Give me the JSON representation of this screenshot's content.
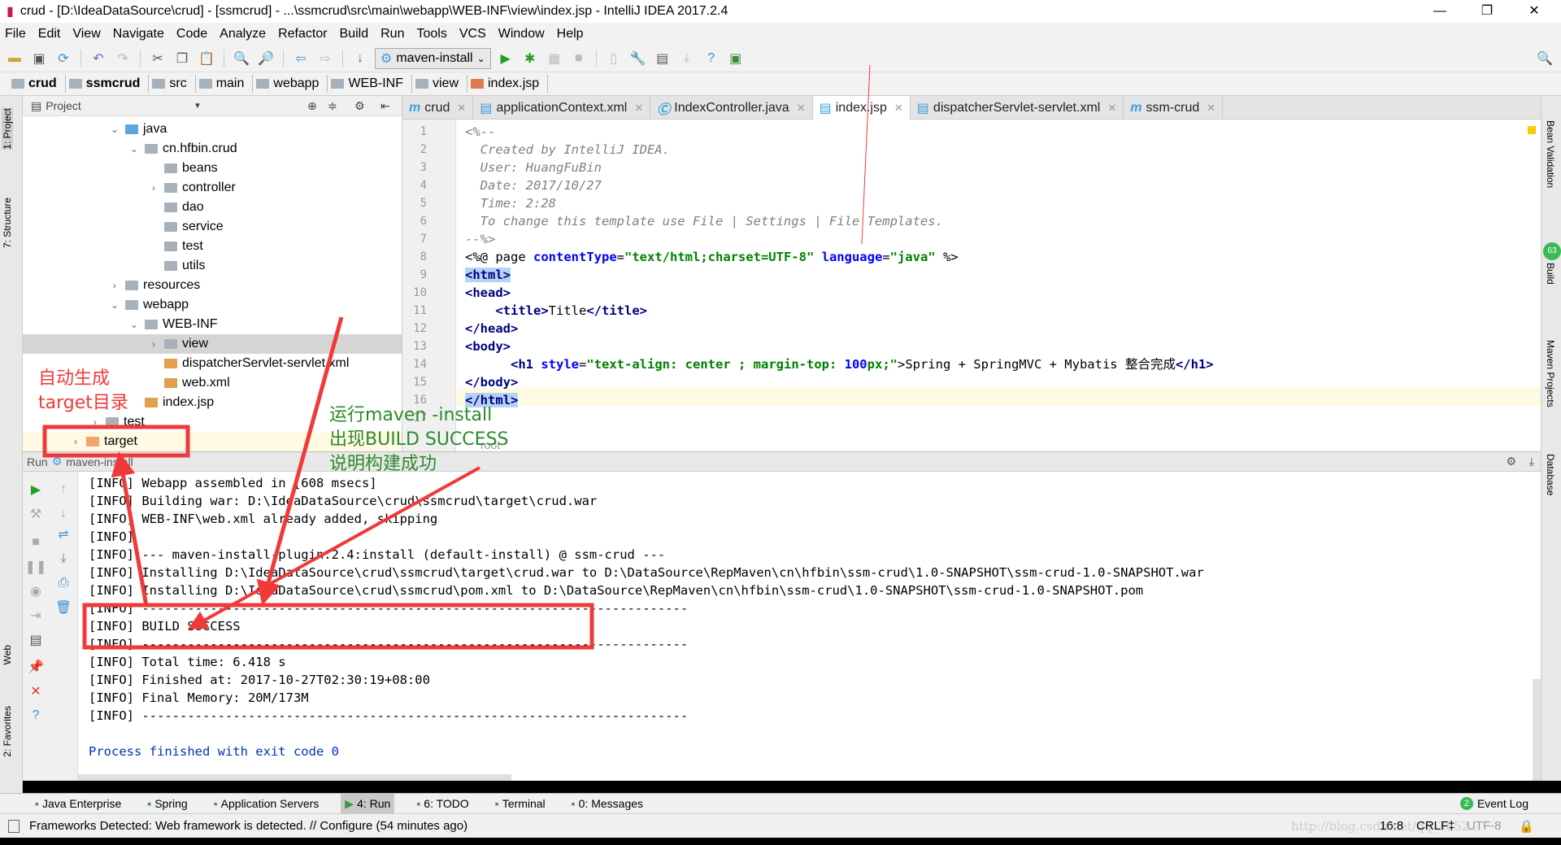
{
  "window": {
    "title": "crud - [D:\\IdeaDataSource\\crud] - [ssmcrud] - ...\\ssmcrud\\src\\main\\webapp\\WEB-INF\\view\\index.jsp - IntelliJ IDEA 2017.2.4",
    "minimize": "—",
    "restore": "❐",
    "close": "✕"
  },
  "menu": [
    "File",
    "Edit",
    "View",
    "Navigate",
    "Code",
    "Analyze",
    "Refactor",
    "Build",
    "Run",
    "Tools",
    "VCS",
    "Window",
    "Help"
  ],
  "toolbar": {
    "run_config": "maven-install"
  },
  "breadcrumb": [
    "crud",
    "ssmcrud",
    "src",
    "main",
    "webapp",
    "WEB-INF",
    "view",
    "index.jsp"
  ],
  "left_stripe": {
    "project": "1: Project",
    "structure": "7: Structure",
    "web": "Web",
    "favorites": "2: Favorites"
  },
  "right_stripe": {
    "bean": "Bean Validation",
    "build": "Build",
    "maven": "Maven Projects",
    "database": "Database",
    "badge": "63"
  },
  "project": {
    "header": "Project",
    "tree": [
      {
        "label": "java",
        "depth": 0,
        "arrow": "⌄"
      },
      {
        "label": "cn.hfbin.crud",
        "depth": 1,
        "arrow": "⌄"
      },
      {
        "label": "beans",
        "depth": 2,
        "arrow": ""
      },
      {
        "label": "controller",
        "depth": 2,
        "arrow": "›"
      },
      {
        "label": "dao",
        "depth": 2,
        "arrow": ""
      },
      {
        "label": "service",
        "depth": 2,
        "arrow": ""
      },
      {
        "label": "test",
        "depth": 2,
        "arrow": ""
      },
      {
        "label": "utils",
        "depth": 2,
        "arrow": ""
      },
      {
        "label": "resources",
        "depth": 0,
        "arrow": "›"
      },
      {
        "label": "webapp",
        "depth": 0,
        "arrow": "⌄"
      },
      {
        "label": "WEB-INF",
        "depth": 1,
        "arrow": "⌄"
      },
      {
        "label": "view",
        "depth": 2,
        "arrow": "›",
        "selected": true
      },
      {
        "label": "dispatcherServlet-servlet.xml",
        "depth": 2,
        "arrow": "",
        "file": true
      },
      {
        "label": "web.xml",
        "depth": 2,
        "arrow": "",
        "file": true
      },
      {
        "label": "index.jsp",
        "depth": 1,
        "arrow": "",
        "file": true
      },
      {
        "label": "test",
        "depth": -1,
        "arrow": "›"
      },
      {
        "label": "target",
        "depth": -2,
        "arrow": "›",
        "orange": true
      }
    ]
  },
  "tabs": [
    {
      "label": "crud",
      "active": false
    },
    {
      "label": "applicationContext.xml",
      "active": false
    },
    {
      "label": "IndexController.java",
      "active": false
    },
    {
      "label": "index.jsp",
      "active": true
    },
    {
      "label": "dispatcherServlet-servlet.xml",
      "active": false
    },
    {
      "label": "ssm-crud",
      "active": false
    }
  ],
  "editor": {
    "lines": [
      "<%--",
      "  Created by IntelliJ IDEA.",
      "  User: HuangFuBin",
      "  Date: 2017/10/27",
      "  Time: 2:28",
      "  To change this template use File | Settings | File Templates.",
      "--%>",
      "<%@ page contentType=\"text/html;charset=UTF-8\" language=\"java\" %>",
      "<html>",
      "<head>",
      "    <title>Title</title>",
      "</head>",
      "<body>",
      "      <h1 style=\"text-align: center ; margin-top: 100px;\">Spring + SpringMVC + Mybatis 整合完成</h1>",
      "</body>",
      "</html>",
      ""
    ],
    "hint": "root"
  },
  "run": {
    "label": "Run",
    "config": "maven-install",
    "console": [
      "[INFO] Webapp assembled in [608 msecs]",
      "[INFO] Building war: D:\\IdeaDataSource\\crud\\ssmcrud\\target\\crud.war",
      "[INFO] WEB-INF\\web.xml already added, skipping",
      "[INFO]",
      "[INFO] --- maven-install-plugin:2.4:install (default-install) @ ssm-crud ---",
      "[INFO] Installing D:\\IdeaDataSource\\crud\\ssmcrud\\target\\crud.war to D:\\DataSource\\RepMaven\\cn\\hfbin\\ssm-crud\\1.0-SNAPSHOT\\ssm-crud-1.0-SNAPSHOT.war",
      "[INFO] Installing D:\\IdeaDataSource\\crud\\ssmcrud\\pom.xml to D:\\DataSource\\RepMaven\\cn\\hfbin\\ssm-crud\\1.0-SNAPSHOT\\ssm-crud-1.0-SNAPSHOT.pom",
      "[INFO] ------------------------------------------------------------------------",
      "[INFO] BUILD SUCCESS",
      "[INFO] ------------------------------------------------------------------------",
      "[INFO] Total time: 6.418 s",
      "[INFO] Finished at: 2017-10-27T02:30:19+08:00",
      "[INFO] Final Memory: 20M/173M",
      "[INFO] ------------------------------------------------------------------------",
      "",
      "Process finished with exit code 0"
    ]
  },
  "bottom_tools": [
    "Java Enterprise",
    "Spring",
    "Application Servers",
    "4: Run",
    "6: TODO",
    "Terminal",
    "0: Messages"
  ],
  "event_log": {
    "label": "Event Log",
    "count": "2"
  },
  "status": {
    "message": "Frameworks Detected: Web framework is detected. // Configure (54 minutes ago)",
    "position": "16:8",
    "line_sep": "CRLF‡",
    "encoding": "UTF-8"
  },
  "annotations": {
    "target_note_1": "自动生成",
    "target_note_2": "target目录",
    "build_note_1": "运行maven -install",
    "build_note_2": "出现BUILD SUCCESS",
    "build_note_3": "说明构建成功",
    "watermark": "http://blog.csdn.net/qq_3852..."
  },
  "colors": {
    "annotation_red": "#f03a3a",
    "annotation_green": "#2c8a2c",
    "selection": "#d5d5d5",
    "current_line": "#fffae3"
  }
}
